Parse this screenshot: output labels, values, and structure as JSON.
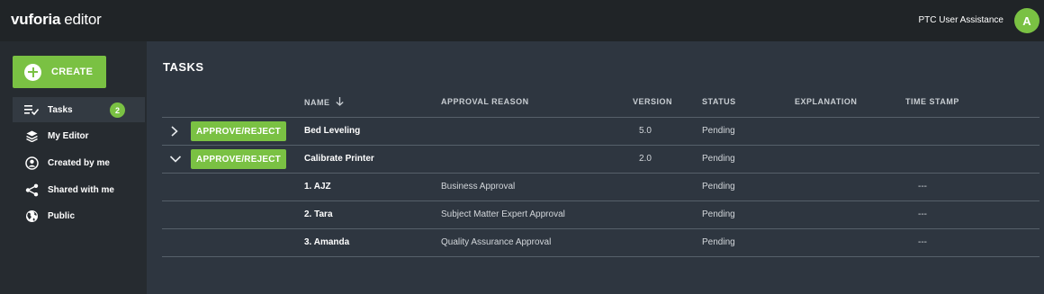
{
  "header": {
    "brand_bold": "vuforia",
    "brand_light": "editor",
    "user_name": "PTC User Assistance",
    "avatar_letter": "A"
  },
  "sidebar": {
    "create_label": "CREATE",
    "items": [
      {
        "label": "Tasks",
        "icon": "tasks-icon",
        "badge": "2",
        "active": true
      },
      {
        "label": "My Editor",
        "icon": "editor-icon"
      },
      {
        "label": "Created by me",
        "icon": "user-circle-icon"
      },
      {
        "label": "Shared with me",
        "icon": "share-icon"
      },
      {
        "label": "Public",
        "icon": "globe-icon"
      }
    ]
  },
  "main": {
    "title": "TASKS",
    "columns": {
      "name": "NAME",
      "approval_reason": "APPROVAL REASON",
      "version": "VERSION",
      "status": "STATUS",
      "explanation": "EXPLANATION",
      "time_stamp": "TIME STAMP"
    },
    "approve_label": "APPROVE/REJECT",
    "tasks": [
      {
        "name": "Bed Leveling",
        "version": "5.0",
        "status": "Pending",
        "expanded": false
      },
      {
        "name": "Calibrate Printer",
        "version": "2.0",
        "status": "Pending",
        "expanded": true
      }
    ],
    "approvers": [
      {
        "name": "1. AJZ",
        "reason": "Business Approval",
        "status": "Pending",
        "time_stamp": "---"
      },
      {
        "name": "2. Tara",
        "reason": "Subject Matter Expert Approval",
        "status": "Pending",
        "time_stamp": "---"
      },
      {
        "name": "3. Amanda",
        "reason": "Quality Assurance Approval",
        "status": "Pending",
        "time_stamp": "---"
      }
    ]
  },
  "colors": {
    "accent": "#7ac143",
    "topbar": "#202427",
    "sidebar": "#262b30",
    "main": "#2e3640"
  }
}
